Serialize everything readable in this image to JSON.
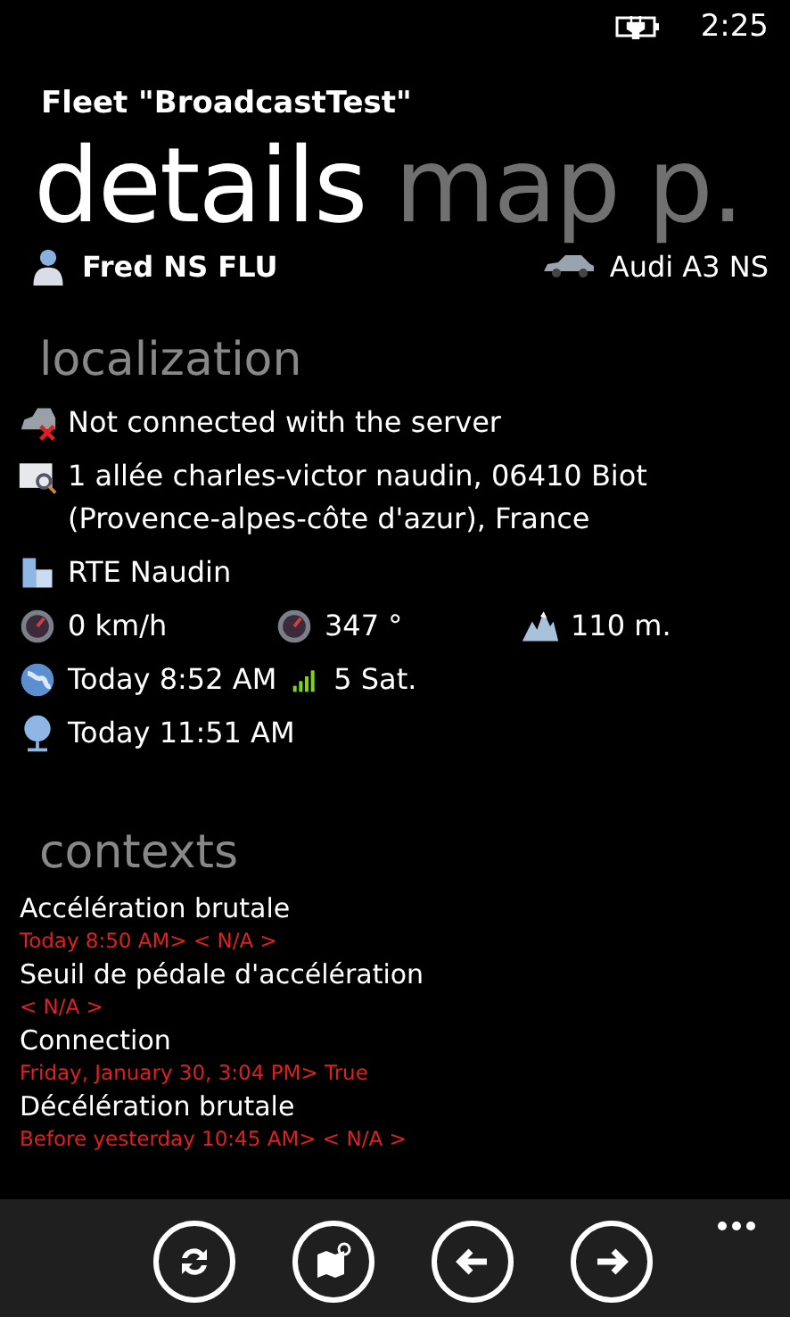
{
  "status_bar": {
    "time": "2:25"
  },
  "app_title": "Fleet \"BroadcastTest\"",
  "pivot": [
    {
      "label": "details",
      "selected": true
    },
    {
      "label": "map",
      "selected": false
    },
    {
      "label": "p.",
      "selected": false
    }
  ],
  "driver": {
    "name": "Fred NS FLU"
  },
  "vehicle": {
    "name": "Audi A3 NS"
  },
  "localization": {
    "title": "localization",
    "rows": [
      {
        "items": [
          {
            "kind": "disconnected",
            "text": "Not connected with the server"
          }
        ]
      },
      {
        "items": [
          {
            "kind": "address",
            "text": "1 allée charles-victor naudin, 06410 Biot (Provence-alpes-côte d'azur), France"
          }
        ]
      },
      {
        "items": [
          {
            "kind": "building",
            "text": "RTE Naudin"
          }
        ]
      },
      {
        "items": [
          {
            "kind": "speed",
            "text": "0 km/h"
          },
          {
            "kind": "heading",
            "text": "347 °"
          },
          {
            "kind": "altitude",
            "text": "110 m."
          }
        ]
      },
      {
        "items": [
          {
            "kind": "gps",
            "text": "Today 8:52 AM"
          },
          {
            "kind": "signal",
            "text": "5 Sat."
          }
        ]
      },
      {
        "items": [
          {
            "kind": "pin",
            "text": "Today 11:51 AM"
          }
        ]
      }
    ]
  },
  "contexts": {
    "title": "contexts",
    "items": [
      {
        "name": "Accélération brutale",
        "value": "Today 8:50 AM> < N/A >"
      },
      {
        "name": "Seuil de pédale d'accélération",
        "value": "< N/A >"
      },
      {
        "name": "Connection",
        "value": "Friday, January 30, 3:04 PM> True"
      },
      {
        "name": "Décélération brutale",
        "value": "Before yesterday 10:45 AM> < N/A >"
      }
    ]
  },
  "app_bar": {
    "buttons": [
      {
        "kind": "refresh"
      },
      {
        "kind": "map"
      },
      {
        "kind": "back"
      },
      {
        "kind": "forward"
      }
    ]
  }
}
